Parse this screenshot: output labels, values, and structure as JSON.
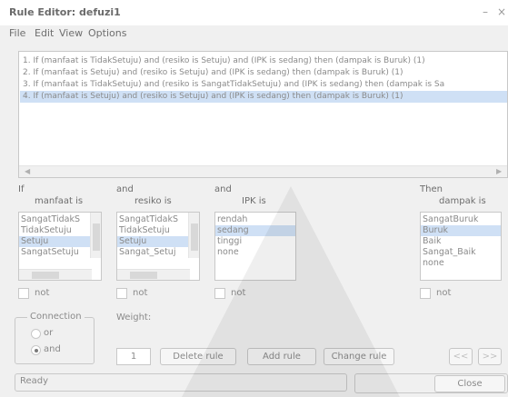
{
  "window": {
    "title": "Rule Editor: defuzi1",
    "minimize_glyph": "–",
    "close_glyph": "×"
  },
  "menu": [
    "File",
    "Edit",
    "View",
    "Options"
  ],
  "rules": [
    "1. If (manfaat is TidakSetuju) and (resiko is Setuju) and (IPK is sedang) then (dampak is Buruk) (1)",
    "2. If (manfaat is Setuju) and (resiko is Setuju) and (IPK is sedang) then (dampak is Buruk) (1)",
    "3. If (manfaat is TidakSetuju) and (resiko is SangatTidakSetuju) and (IPK is sedang) then (dampak is Sa",
    "4. If (manfaat is Setuju) and (resiko is Setuju) and (IPK is sedang) then (dampak is Buruk) (1)"
  ],
  "selected_rule_index": 3,
  "antecedents": [
    {
      "prefix": "If",
      "var_label": "manfaat is",
      "items": [
        "SangatTidakS",
        "TidakSetuju",
        "Setuju",
        "SangatSetuju"
      ],
      "selected_index": 2,
      "not_label": "not"
    },
    {
      "prefix": "and",
      "var_label": "resiko is",
      "items": [
        "SangatTidakS",
        "TidakSetuju",
        "Setuju",
        "Sangat_Setuj"
      ],
      "selected_index": 2,
      "not_label": "not"
    },
    {
      "prefix": "and",
      "var_label": "IPK is",
      "items": [
        "rendah",
        "sedang",
        "tinggi",
        "none"
      ],
      "selected_index": 1,
      "not_label": "not"
    }
  ],
  "consequent": {
    "prefix": "Then",
    "var_label": "dampak is",
    "items": [
      "SangatBuruk",
      "Buruk",
      "Baik",
      "Sangat_Baik",
      "none"
    ],
    "selected_index": 1,
    "not_label": "not"
  },
  "connection": {
    "label": "Connection",
    "options": [
      "or",
      "and"
    ],
    "selected": "and"
  },
  "weight": {
    "label": "Weight:",
    "value": "1"
  },
  "buttons": {
    "delete": "Delete rule",
    "add": "Add rule",
    "change": "Change rule",
    "prev": "<<",
    "next": ">>",
    "close": "Close"
  },
  "status": "Ready"
}
